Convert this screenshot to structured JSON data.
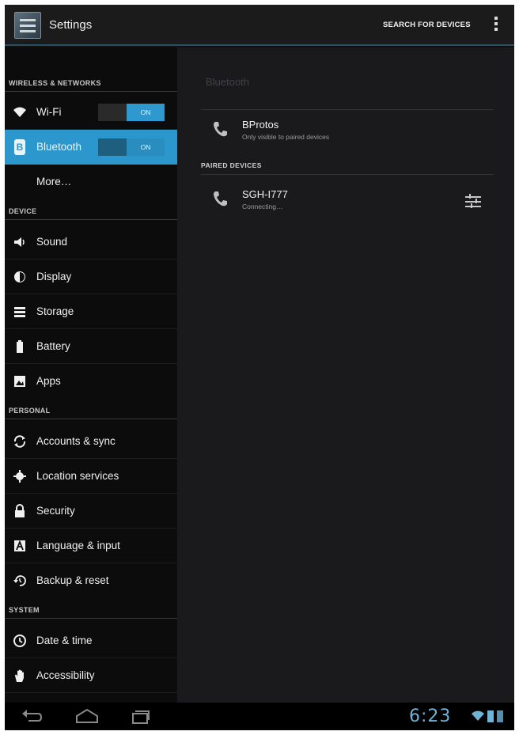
{
  "action_bar": {
    "title": "Settings",
    "search_label": "SEARCH FOR DEVICES"
  },
  "sidebar": {
    "sections": {
      "wireless": "WIRELESS & NETWORKS",
      "device": "DEVICE",
      "personal": "PERSONAL",
      "system": "SYSTEM"
    },
    "wifi": {
      "label": "Wi-Fi",
      "toggle": "ON"
    },
    "bluetooth": {
      "label": "Bluetooth",
      "toggle": "ON",
      "badge": "B"
    },
    "more": {
      "label": "More…"
    },
    "device_items": [
      {
        "label": "Sound",
        "icon": "speaker-icon"
      },
      {
        "label": "Display",
        "icon": "brightness-icon"
      },
      {
        "label": "Storage",
        "icon": "storage-icon"
      },
      {
        "label": "Battery",
        "icon": "battery-icon"
      },
      {
        "label": "Apps",
        "icon": "apps-icon"
      }
    ],
    "personal_items": [
      {
        "label": "Accounts & sync",
        "icon": "sync-icon"
      },
      {
        "label": "Location services",
        "icon": "location-icon"
      },
      {
        "label": "Security",
        "icon": "lock-icon"
      },
      {
        "label": "Language & input",
        "icon": "keyboard-icon"
      },
      {
        "label": "Backup & reset",
        "icon": "backup-icon"
      }
    ],
    "system_items": [
      {
        "label": "Date & time",
        "icon": "clock-icon"
      },
      {
        "label": "Accessibility",
        "icon": "hand-icon"
      }
    ]
  },
  "detail": {
    "title": "Bluetooth",
    "this_device": {
      "name": "BProtos",
      "status": "Only visible to paired devices"
    },
    "paired_header": "PAIRED DEVICES",
    "paired": [
      {
        "name": "SGH-I777",
        "status": "Connecting…"
      }
    ]
  },
  "status_bar": {
    "time": "6:23"
  },
  "colors": {
    "accent": "#2c97cd",
    "clock": "#6fb3d6"
  }
}
